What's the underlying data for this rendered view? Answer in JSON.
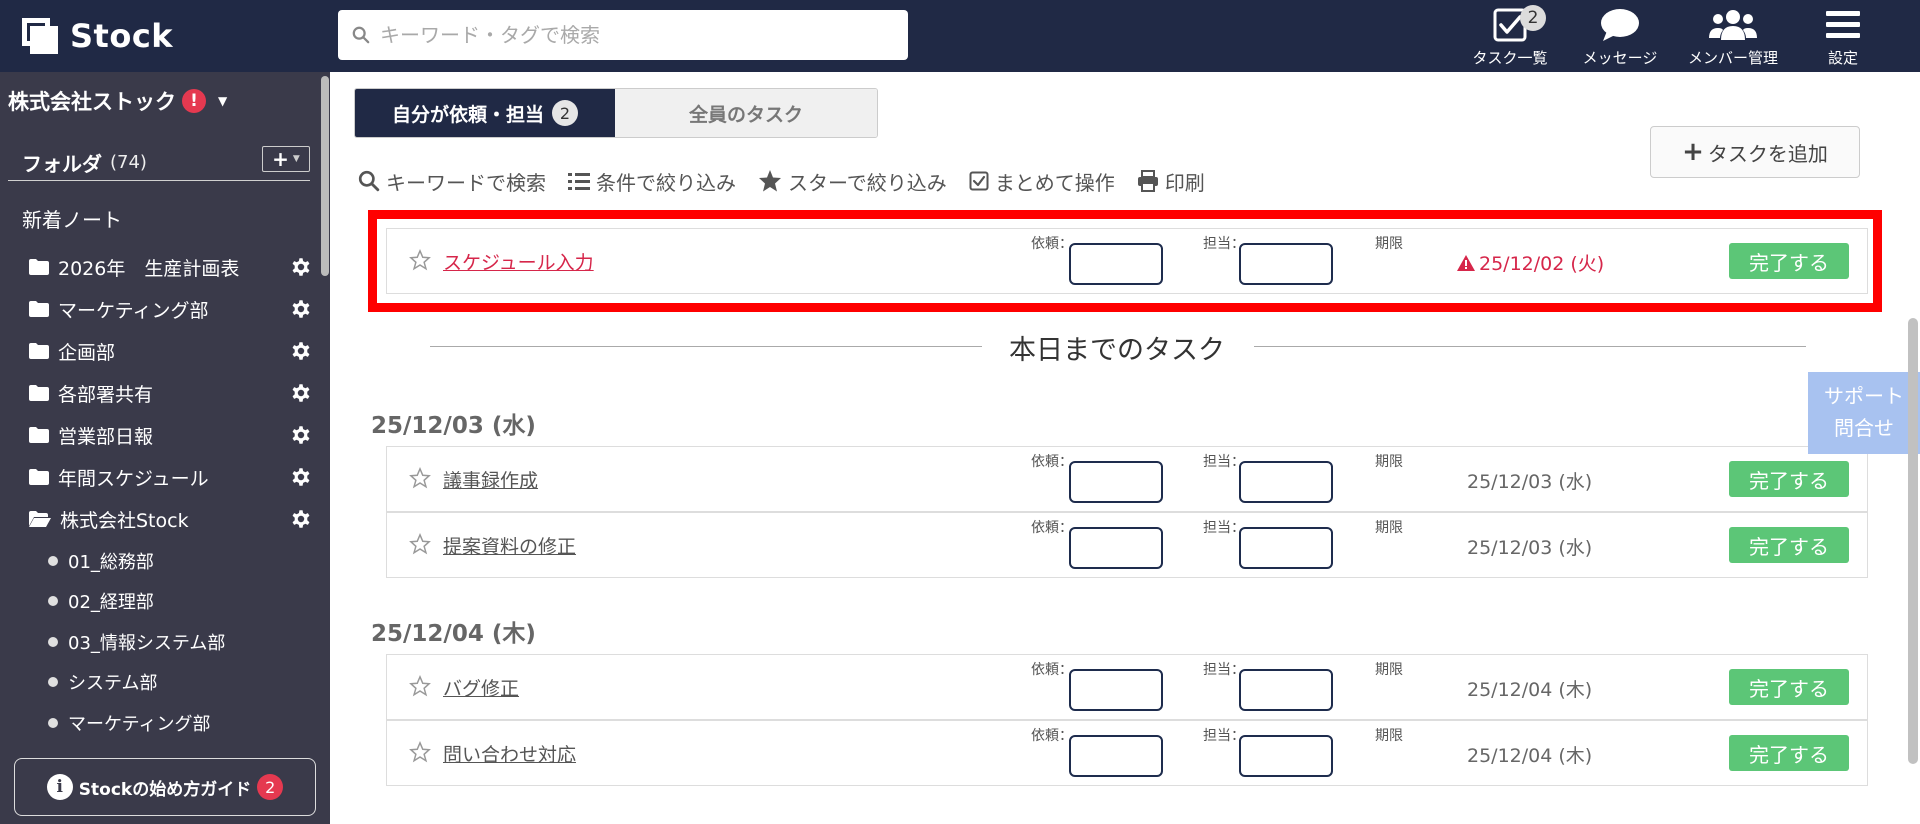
{
  "header": {
    "logo_text": "Stock",
    "search_placeholder": "キーワード・タグで検索",
    "nav": [
      {
        "label": "タスク一覧",
        "icon": "check-square-icon",
        "badge": "2"
      },
      {
        "label": "メッセージ",
        "icon": "chat-bubble-icon"
      },
      {
        "label": "メンバー管理",
        "icon": "users-icon"
      },
      {
        "label": "設定",
        "icon": "menu-icon"
      }
    ]
  },
  "sidebar": {
    "company_name": "株式会社ストック",
    "company_alert": "!",
    "folder_label": "フォルダ",
    "folder_count": "(74)",
    "add_label": "+",
    "new_note": "新着ノート",
    "folders": [
      {
        "label": "2026年　生産計画表",
        "icon": "folder-icon"
      },
      {
        "label": "マーケティング部",
        "icon": "folder-icon"
      },
      {
        "label": "企画部",
        "icon": "folder-icon"
      },
      {
        "label": "各部署共有",
        "icon": "folder-icon"
      },
      {
        "label": "営業部日報",
        "icon": "folder-icon"
      },
      {
        "label": "年間スケジュール",
        "icon": "folder-icon"
      },
      {
        "label": "株式会社Stock",
        "icon": "folder-open-icon"
      }
    ],
    "subfolders": [
      "01_総務部",
      "02_経理部",
      "03_情報システム部",
      "システム部",
      "マーケティング部"
    ],
    "guide_label": "Stockの始め方ガイド",
    "guide_badge": "2"
  },
  "main": {
    "tabs": [
      {
        "label": "自分が依頼・担当",
        "badge": "2",
        "active": true
      },
      {
        "label": "全員のタスク",
        "active": false
      }
    ],
    "add_task_label": "タスクを追加",
    "toolbar": [
      {
        "label": "キーワードで検索",
        "icon": "search-icon"
      },
      {
        "label": "条件で絞り込み",
        "icon": "list-icon"
      },
      {
        "label": "スターで絞り込み",
        "icon": "star-icon"
      },
      {
        "label": "まとめて操作",
        "icon": "checkbox-icon"
      },
      {
        "label": "印刷",
        "icon": "printer-icon"
      }
    ],
    "field_labels": {
      "requester": "依頼：",
      "assignee": "担当：",
      "deadline": "期限"
    },
    "done_label": "完了する",
    "overdue_task": {
      "title": "スケジュール入力",
      "due": "25/12/02 (火)"
    },
    "section_title": "本日までのタスク",
    "groups": [
      {
        "date": "25/12/03 (水)",
        "tasks": [
          {
            "title": "議事録作成",
            "due": "25/12/03 (水)"
          },
          {
            "title": "提案資料の修正",
            "due": "25/12/03 (水)"
          }
        ]
      },
      {
        "date": "25/12/04 (木)",
        "tasks": [
          {
            "title": "バグ修正",
            "due": "25/12/04 (木)"
          },
          {
            "title": "問い合わせ対応",
            "due": "25/12/04 (木)"
          }
        ]
      }
    ],
    "support_line1": "サポート",
    "support_line2": "問合せ"
  },
  "colors": {
    "header_bg": "#202945",
    "sidebar_bg": "#3a3a4a",
    "done_green": "#5cc677",
    "overdue_red": "#d6264a",
    "highlight_red": "#ff0000"
  }
}
